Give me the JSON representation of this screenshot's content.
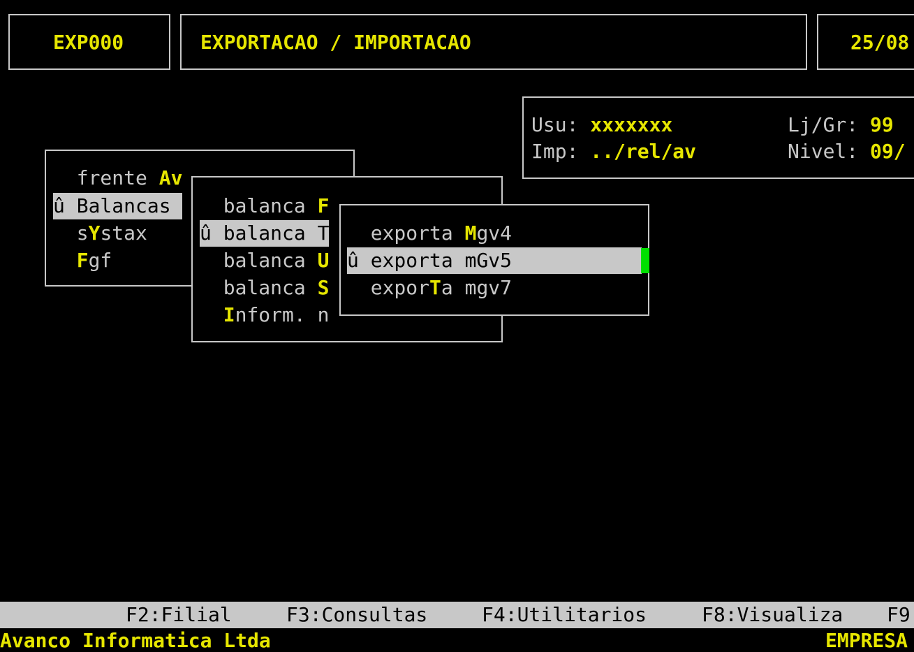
{
  "header": {
    "code": "EXP000",
    "title": "EXPORTACAO / IMPORTACAO",
    "date": "25/08"
  },
  "userinfo": {
    "usu_label": "Usu: ",
    "usu_value": "xxxxxxx",
    "lj_label": "Lj/Gr: ",
    "lj_value": "99",
    "imp_label": "Imp: ",
    "imp_value": "../rel/av",
    "nivel_label": "Nivel: ",
    "nivel_value": "09/"
  },
  "menu1": {
    "items": [
      {
        "pre": "  frente ",
        "hot": "Av",
        "post": ""
      },
      {
        "pre": "û Balancas",
        "hot": "",
        "post": " "
      },
      {
        "pre": "  s",
        "hot": "Y",
        "post": "stax"
      },
      {
        "pre": "  ",
        "hot": "F",
        "post": "gf"
      }
    ]
  },
  "menu2": {
    "items": [
      {
        "pre": "  balanca ",
        "hot": "F",
        "post": ""
      },
      {
        "pre": "û balanca T",
        "hot": "",
        "post": ""
      },
      {
        "pre": "  balanca ",
        "hot": "U",
        "post": ""
      },
      {
        "pre": "  balanca ",
        "hot": "S",
        "post": ""
      },
      {
        "pre": "  ",
        "hot": "I",
        "post": "nform. n"
      }
    ]
  },
  "menu3": {
    "items": [
      {
        "pre": "  exporta ",
        "hot": "M",
        "post": "gv4"
      },
      {
        "pre": "û exporta mGv5",
        "hot": "",
        "post": ""
      },
      {
        "pre": "  expor",
        "hot": "T",
        "post": "a mgv7"
      }
    ]
  },
  "fkeys": [
    "F2:Filial",
    "F3:Consultas",
    "F4:Utilitarios",
    "F8:Visualiza",
    "F9"
  ],
  "footer": {
    "company": "Avanco Informatica Ltda",
    "empresa": "EMPRESA"
  },
  "colors": {
    "background": "#000000",
    "text": "#c8c8c8",
    "highlight": "#e6e600",
    "selection": "#c8c8c8",
    "cursor": "#00e000"
  }
}
